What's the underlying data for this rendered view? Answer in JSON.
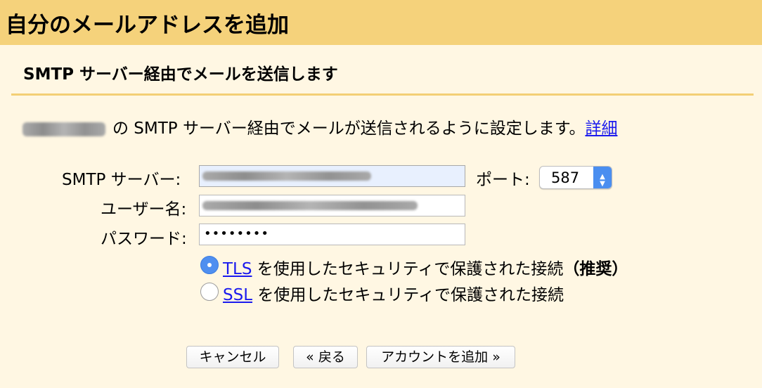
{
  "header": {
    "title": "自分のメールアドレスを追加"
  },
  "section": {
    "subtitle": "SMTP サーバー経由でメールを送信します",
    "description": "の SMTP サーバー経由でメールが送信されるように設定します。",
    "details_link": "詳細"
  },
  "form": {
    "smtp_server_label": "SMTP サーバー:",
    "port_label": "ポート:",
    "port_value": "587",
    "username_label": "ユーザー名:",
    "password_label": "パスワード:",
    "password_mask": "••••••••"
  },
  "security": {
    "tls_link": "TLS",
    "tls_text": "を使用したセキュリティで保護された接続",
    "tls_recommended": "（推奨）",
    "ssl_link": "SSL",
    "ssl_text": "を使用したセキュリティで保護された接続",
    "selected": "TLS"
  },
  "buttons": {
    "cancel": "キャンセル",
    "back": "« 戻る",
    "add_account": "アカウントを追加 »"
  },
  "colors": {
    "header_bg": "#f5d27b",
    "panel_bg": "#fff7e3",
    "link": "#1a1aee",
    "radio_selected": "#4f8ff0"
  }
}
